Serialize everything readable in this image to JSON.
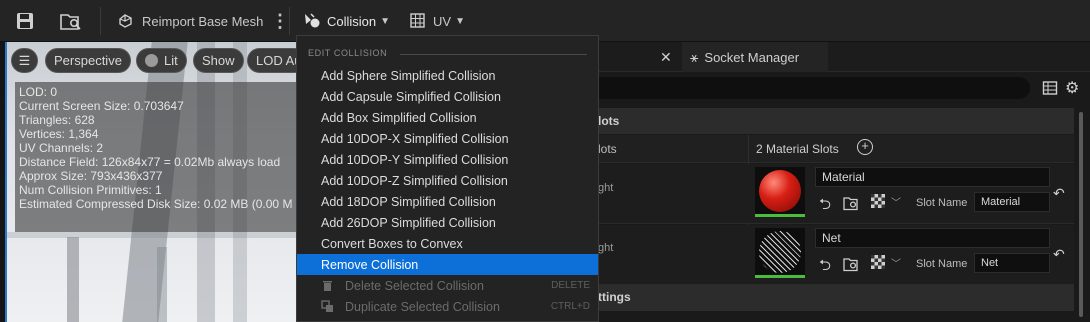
{
  "toolbar": {
    "reimport_label": "Reimport Base Mesh",
    "collision_label": "Collision",
    "uv_label": "UV"
  },
  "viewport": {
    "perspective": "Perspective",
    "lit": "Lit",
    "show": "Show",
    "lod": "LOD Au",
    "stats": [
      "LOD:  0",
      "Current Screen Size:  0.703647",
      "Triangles:  628",
      "Vertices:  1,364",
      "UV Channels:  2",
      "Distance Field:  126x84x77 = 0.02Mb always load",
      "Approx Size: 793x436x377",
      "Num Collision Primitives:  1",
      "Estimated Compressed Disk Size: 0.02 MB (0.00 M"
    ]
  },
  "menu": {
    "header": "EDIT COLLISION",
    "items": [
      "Add Sphere Simplified Collision",
      "Add Capsule Simplified Collision",
      "Add Box Simplified Collision",
      "Add 10DOP-X Simplified Collision",
      "Add 10DOP-Y Simplified Collision",
      "Add 10DOP-Z Simplified Collision",
      "Add 18DOP Simplified Collision",
      "Add 26DOP Simplified Collision",
      "Convert Boxes to Convex",
      "Remove Collision"
    ],
    "delete_label": "Delete Selected Collision",
    "delete_shortcut": "DELETE",
    "duplicate_label": "Duplicate Selected Collision",
    "duplicate_shortcut": "CTRL+D"
  },
  "details": {
    "socket_tab": "Socket Manager",
    "section_lots": "lots",
    "lots_label": "lots",
    "material_slots_count": "2 Material Slots",
    "ght_1": "ght",
    "ght_2": "ght",
    "material_name": "Material",
    "slot_name_label": "Slot Name",
    "slot_material_value": "Material",
    "net_name": "Net",
    "slot_name_label_2": "Slot Name",
    "slot_net_value": "Net",
    "settings_partial": "ttings"
  },
  "colors": {
    "accent": "#0d6fd8",
    "viewport_border": "#2e77c9",
    "material_red": "#d81f14",
    "green_bar": "#4cbc3c"
  }
}
